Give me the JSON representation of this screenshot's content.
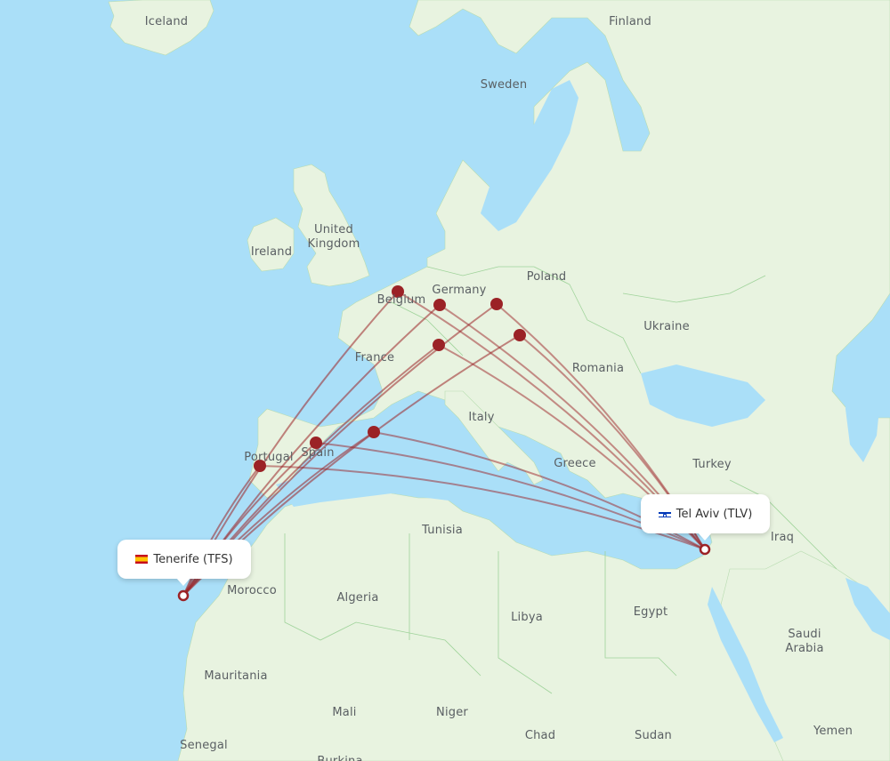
{
  "map": {
    "colors": {
      "water": "#aadff8",
      "land": "#e8f3e0",
      "border": "#9fd39a",
      "route": "#9b2226",
      "hub": "#9b2226",
      "label": "#5a5f63"
    },
    "country_labels": [
      {
        "id": "iceland",
        "text": "Iceland"
      },
      {
        "id": "finland",
        "text": "Finland"
      },
      {
        "id": "sweden",
        "text": "Sweden"
      },
      {
        "id": "united-kingdom-1",
        "text": "United"
      },
      {
        "id": "united-kingdom-2",
        "text": "Kingdom"
      },
      {
        "id": "ireland",
        "text": "Ireland"
      },
      {
        "id": "poland",
        "text": "Poland"
      },
      {
        "id": "germany",
        "text": "Germany"
      },
      {
        "id": "belgium",
        "text": "Belgium"
      },
      {
        "id": "ukraine",
        "text": "Ukraine"
      },
      {
        "id": "france",
        "text": "France"
      },
      {
        "id": "romania",
        "text": "Romania"
      },
      {
        "id": "italy",
        "text": "Italy"
      },
      {
        "id": "spain",
        "text": "Spain"
      },
      {
        "id": "portugal",
        "text": "Portugal"
      },
      {
        "id": "greece",
        "text": "Greece"
      },
      {
        "id": "turkey",
        "text": "Turkey"
      },
      {
        "id": "tunisia",
        "text": "Tunisia"
      },
      {
        "id": "iraq",
        "text": "Iraq"
      },
      {
        "id": "morocco",
        "text": "Morocco"
      },
      {
        "id": "algeria",
        "text": "Algeria"
      },
      {
        "id": "libya",
        "text": "Libya"
      },
      {
        "id": "egypt",
        "text": "Egypt"
      },
      {
        "id": "saudi-arabia-1",
        "text": "Saudi"
      },
      {
        "id": "saudi-arabia-2",
        "text": "Arabia"
      },
      {
        "id": "mauritania",
        "text": "Mauritania"
      },
      {
        "id": "mali",
        "text": "Mali"
      },
      {
        "id": "niger",
        "text": "Niger"
      },
      {
        "id": "chad",
        "text": "Chad"
      },
      {
        "id": "sudan",
        "text": "Sudan"
      },
      {
        "id": "yemen",
        "text": "Yemen"
      },
      {
        "id": "senegal",
        "text": "Senegal"
      },
      {
        "id": "burkina",
        "text": "Burkina"
      }
    ],
    "origin": {
      "name": "Tenerife (TFS)",
      "flag": "spain-flag"
    },
    "destination": {
      "name": "Tel Aviv (TLV)",
      "flag": "israel-flag"
    },
    "hubs": [
      {
        "id": "brussels"
      },
      {
        "id": "frankfurt"
      },
      {
        "id": "prague"
      },
      {
        "id": "vienna"
      },
      {
        "id": "zurich"
      },
      {
        "id": "barcelona"
      },
      {
        "id": "madrid"
      },
      {
        "id": "lisbon"
      }
    ]
  }
}
